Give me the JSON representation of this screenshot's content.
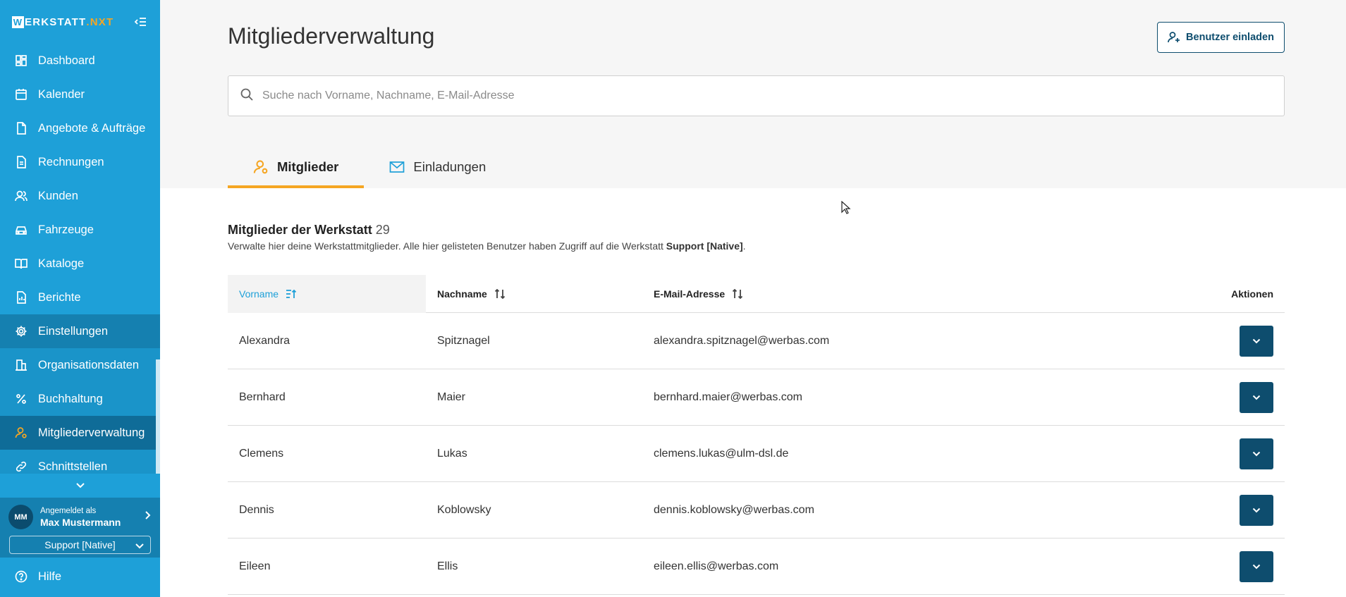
{
  "app": {
    "logo_prefix": "W",
    "logo_main": "ERKSTATT",
    "logo_dot": ".",
    "logo_suffix": "NXT"
  },
  "sidebar": {
    "items": [
      {
        "label": "Dashboard",
        "icon": "dashboard-icon"
      },
      {
        "label": "Kalender",
        "icon": "calendar-icon"
      },
      {
        "label": "Angebote & Aufträge",
        "icon": "document-icon"
      },
      {
        "label": "Rechnungen",
        "icon": "invoice-icon"
      },
      {
        "label": "Kunden",
        "icon": "users-icon"
      },
      {
        "label": "Fahrzeuge",
        "icon": "car-icon"
      },
      {
        "label": "Kataloge",
        "icon": "book-icon"
      },
      {
        "label": "Berichte",
        "icon": "report-icon"
      },
      {
        "label": "Einstellungen",
        "icon": "gear-icon"
      },
      {
        "label": "Organisationsdaten",
        "icon": "building-icon"
      },
      {
        "label": "Buchhaltung",
        "icon": "percent-icon"
      },
      {
        "label": "Mitgliederverwaltung",
        "icon": "user-gear-icon"
      },
      {
        "label": "Schnittstellen",
        "icon": "link-icon"
      }
    ],
    "user": {
      "initials": "MM",
      "logged_in_as": "Angemeldet als",
      "name": "Max Mustermann"
    },
    "workshop": "Support [Native]",
    "help": "Hilfe"
  },
  "header": {
    "title": "Mitgliederverwaltung",
    "invite_label": "Benutzer einladen"
  },
  "search": {
    "placeholder": "Suche nach Vorname, Nachname, E-Mail-Adresse",
    "value": ""
  },
  "tabs": [
    {
      "label": "Mitglieder"
    },
    {
      "label": "Einladungen"
    }
  ],
  "members": {
    "title": "Mitglieder der Werkstatt",
    "count": "29",
    "description_prefix": "Verwalte hier deine Werkstattmitglieder. Alle hier gelisteten Benutzer haben Zugriff auf die Werkstatt ",
    "description_workshop": "Support [Native]",
    "description_suffix": ".",
    "columns": {
      "firstname": "Vorname",
      "lastname": "Nachname",
      "email": "E-Mail-Adresse",
      "actions": "Aktionen"
    },
    "rows": [
      {
        "firstname": "Alexandra",
        "lastname": "Spitznagel",
        "email": "alexandra.spitznagel@werbas.com"
      },
      {
        "firstname": "Bernhard",
        "lastname": "Maier",
        "email": "bernhard.maier@werbas.com"
      },
      {
        "firstname": "Clemens",
        "lastname": "Lukas",
        "email": "clemens.lukas@ulm-dsl.de"
      },
      {
        "firstname": "Dennis",
        "lastname": "Koblowsky",
        "email": "dennis.koblowsky@werbas.com"
      },
      {
        "firstname": "Eileen",
        "lastname": "Ellis",
        "email": "eileen.ellis@werbas.com"
      }
    ]
  },
  "colors": {
    "sidebar": "#1ea0d8",
    "accent": "#f5a623",
    "primary_dark": "#0e4d6e"
  }
}
